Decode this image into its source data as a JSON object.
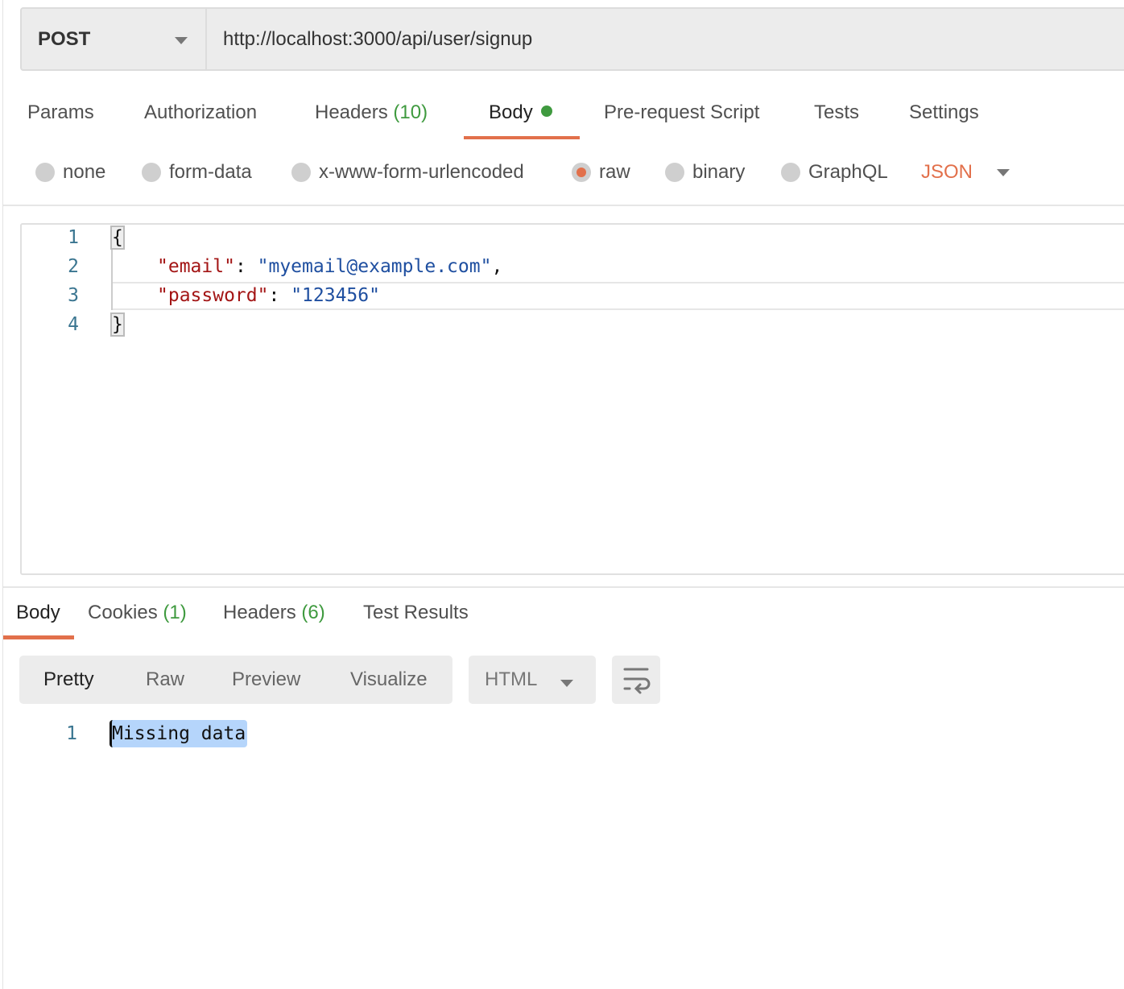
{
  "request": {
    "method": "POST",
    "url": "http://localhost:3000/api/user/signup"
  },
  "request_tabs": [
    {
      "label": "Params"
    },
    {
      "label": "Authorization"
    },
    {
      "label": "Headers",
      "count": "(10)"
    },
    {
      "label": "Body",
      "active": true
    },
    {
      "label": "Pre-request Script"
    },
    {
      "label": "Tests"
    },
    {
      "label": "Settings"
    }
  ],
  "body_types": [
    {
      "label": "none"
    },
    {
      "label": "form-data"
    },
    {
      "label": "x-www-form-urlencoded"
    },
    {
      "label": "raw",
      "selected": true
    },
    {
      "label": "binary"
    },
    {
      "label": "GraphQL"
    }
  ],
  "body_format": "JSON",
  "editor": {
    "line_numbers": [
      "1",
      "2",
      "3",
      "4"
    ],
    "open": "{",
    "email_key": "\"email\"",
    "email_val": "\"myemail@example.com\"",
    "password_key": "\"password\"",
    "password_val": "\"123456\"",
    "close": "}",
    "colon": ": ",
    "comma": ","
  },
  "response_tabs": [
    {
      "label": "Body",
      "active": true
    },
    {
      "label": "Cookies",
      "count": "(1)"
    },
    {
      "label": "Headers",
      "count": "(6)"
    },
    {
      "label": "Test Results"
    }
  ],
  "view_modes": [
    "Pretty",
    "Raw",
    "Preview",
    "Visualize"
  ],
  "response_format": "HTML",
  "response": {
    "line_numbers": [
      "1"
    ],
    "text": "Missing data"
  },
  "colors": {
    "accent": "#e2704b",
    "count": "#3f9a3f"
  }
}
